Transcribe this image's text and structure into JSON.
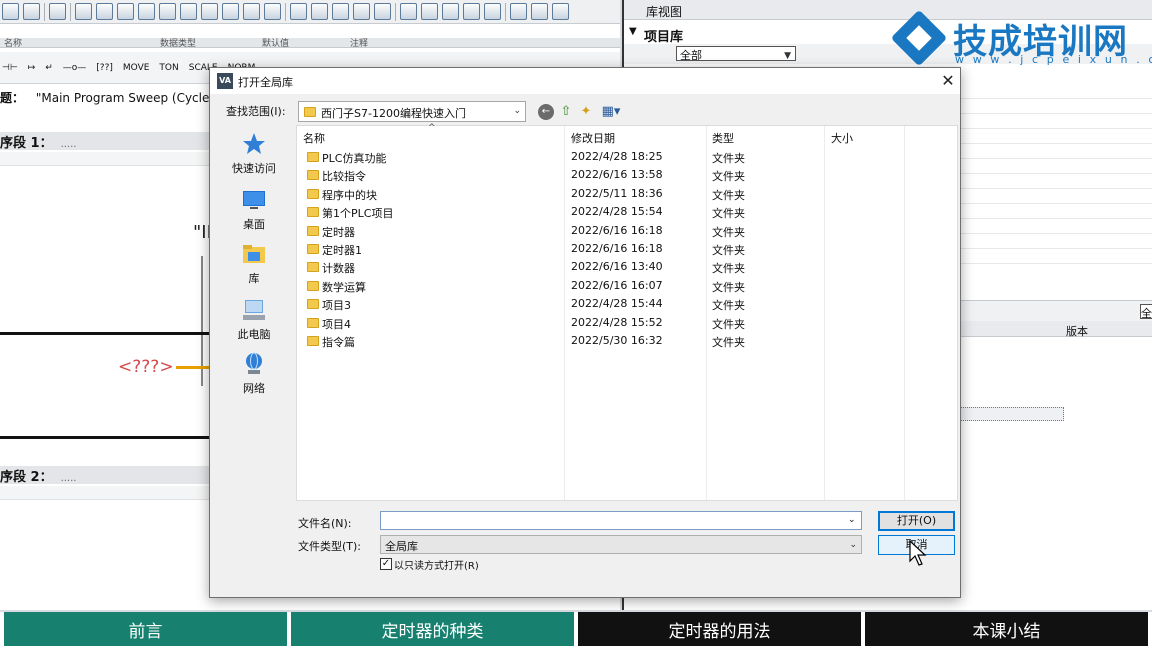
{
  "background": {
    "column_headers": [
      "名称",
      "数据类型",
      "默认值",
      "注释"
    ],
    "ladder_labels": [
      "MOVE",
      "TON",
      "SCALE",
      "NORM"
    ],
    "block_title_label": "题：",
    "block_title_value": "\"Main Program Sweep (Cycle)\"",
    "segment1": "序段 1：",
    "segment2": "序段 2：",
    "segment_dots": ".....",
    "unknown_operand": "<???>",
    "quote_fragment": "\"II"
  },
  "library": {
    "view_label": "库视图",
    "project_library": "项目库",
    "filter_value": "全部",
    "version_header": "版本",
    "lower_filter_fragment": "全"
  },
  "watermark": {
    "title": "技成培训网",
    "url": "w w w . j c p e i x u n . c o m"
  },
  "bottom_nav": [
    "前言",
    "定时器的种类",
    "定时器的用法",
    "本课小结"
  ],
  "dialog": {
    "app_icon_text": "VA",
    "title": "打开全局库",
    "close_glyph": "✕",
    "lookin_label": "查找范围(I):",
    "lookin_value": "西门子S7-1200编程快速入门",
    "places": [
      {
        "label": "快速访问",
        "icon": "star-icon"
      },
      {
        "label": "桌面",
        "icon": "desktop-icon"
      },
      {
        "label": "库",
        "icon": "libraries-icon"
      },
      {
        "label": "此电脑",
        "icon": "computer-icon"
      },
      {
        "label": "网络",
        "icon": "network-icon"
      }
    ],
    "columns": {
      "name": "名称",
      "date": "修改日期",
      "type": "类型",
      "size": "大小"
    },
    "files": [
      {
        "name": "PLC仿真功能",
        "date": "2022/4/28 18:25",
        "type": "文件夹"
      },
      {
        "name": "比较指令",
        "date": "2022/6/16 13:58",
        "type": "文件夹"
      },
      {
        "name": "程序中的块",
        "date": "2022/5/11 18:36",
        "type": "文件夹"
      },
      {
        "name": "第1个PLC项目",
        "date": "2022/4/28 15:54",
        "type": "文件夹"
      },
      {
        "name": "定时器",
        "date": "2022/6/16 16:18",
        "type": "文件夹"
      },
      {
        "name": "定时器1",
        "date": "2022/6/16 16:18",
        "type": "文件夹"
      },
      {
        "name": "计数器",
        "date": "2022/6/16 13:40",
        "type": "文件夹"
      },
      {
        "name": "数学运算",
        "date": "2022/6/16 16:07",
        "type": "文件夹"
      },
      {
        "name": "项目3",
        "date": "2022/4/28 15:44",
        "type": "文件夹"
      },
      {
        "name": "项目4",
        "date": "2022/4/28 15:52",
        "type": "文件夹"
      },
      {
        "name": "指令篇",
        "date": "2022/5/30 16:32",
        "type": "文件夹"
      }
    ],
    "filename_label": "文件名(N):",
    "filename_value": "",
    "filetype_label": "文件类型(T):",
    "filetype_value": "全局库",
    "readonly_label": "以只读方式打开(R)",
    "readonly_checked": true,
    "open_button": "打开(O)",
    "cancel_button": "取消"
  }
}
